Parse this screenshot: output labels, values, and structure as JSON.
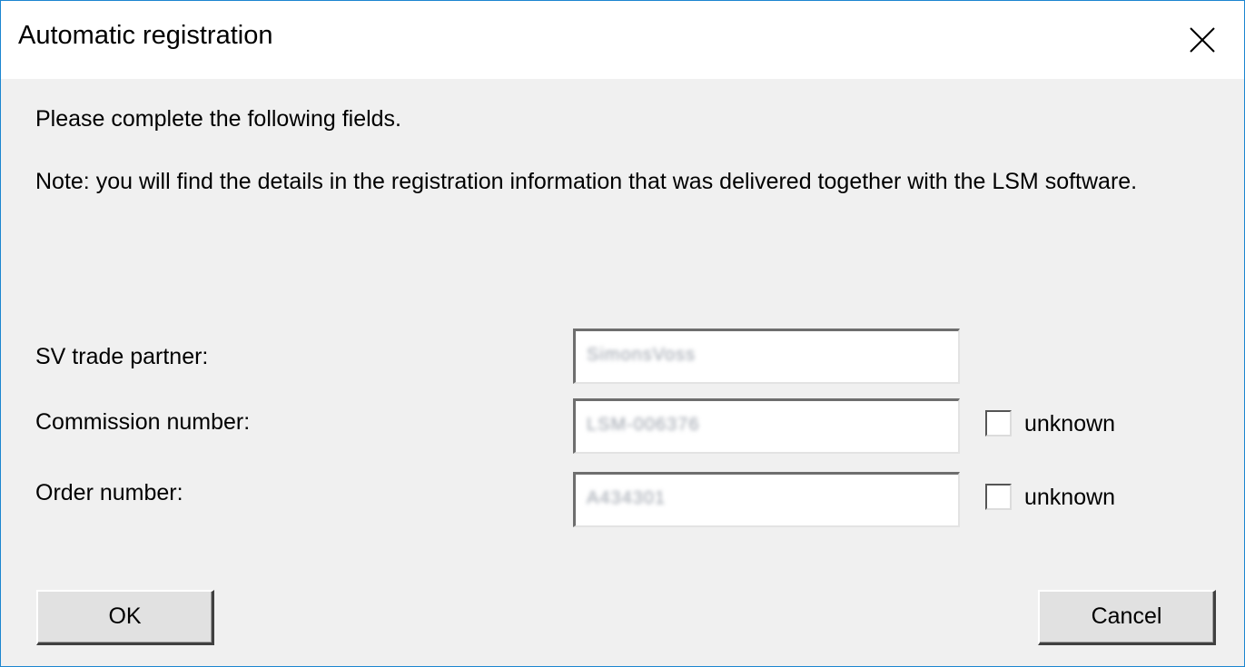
{
  "dialog": {
    "title": "Automatic registration",
    "intro": "Please complete the following fields.",
    "note": "Note: you will find the details in the registration information that was delivered together with the LSM software."
  },
  "fields": {
    "trade_partner": {
      "label": "SV trade partner:",
      "value": "SimonsVoss"
    },
    "commission_number": {
      "label": "Commission number:",
      "value": "LSM-006376",
      "unknown_label": "unknown",
      "unknown_checked": false
    },
    "order_number": {
      "label": "Order number:",
      "value": "A434301",
      "unknown_label": "unknown",
      "unknown_checked": false
    }
  },
  "buttons": {
    "ok": "OK",
    "cancel": "Cancel"
  },
  "icons": {
    "close": "close-icon"
  }
}
